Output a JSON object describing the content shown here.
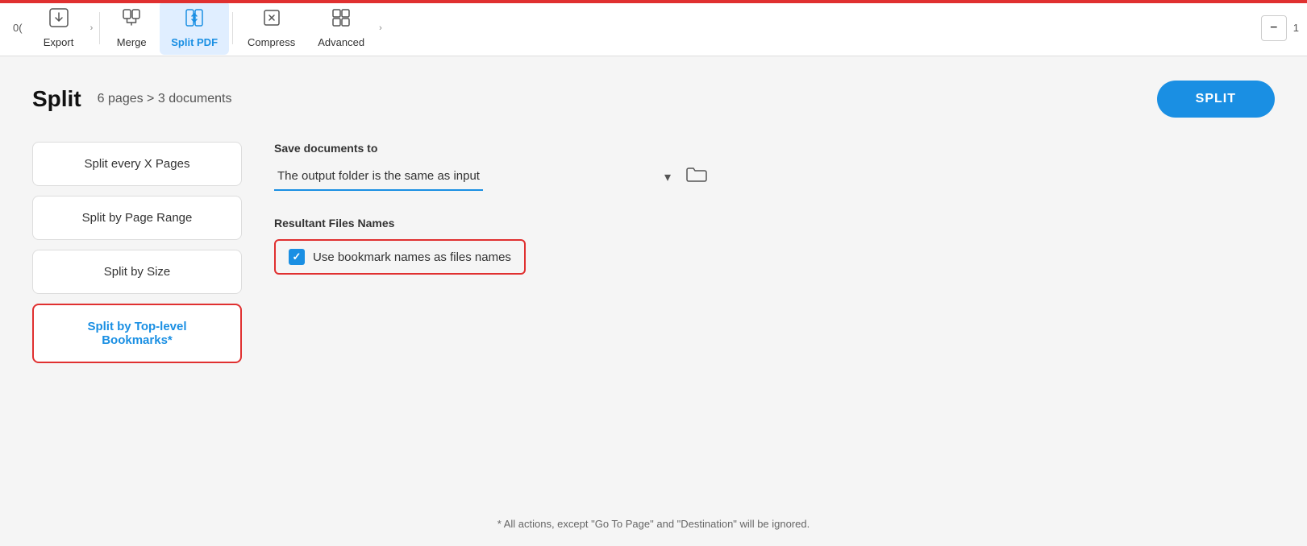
{
  "toolbar": {
    "export_label": "Export",
    "merge_label": "Merge",
    "split_pdf_label": "Split PDF",
    "compress_label": "Compress",
    "advanced_label": "Advanced",
    "chevron_right": "›",
    "zoom_minus": "−"
  },
  "page": {
    "title": "Split",
    "subtitle": "6 pages > 3 documents",
    "split_button_label": "SPLIT"
  },
  "split_options": [
    {
      "id": "split-every-x",
      "label": "Split every X Pages",
      "active": false
    },
    {
      "id": "split-page-range",
      "label": "Split by Page Range",
      "active": false
    },
    {
      "id": "split-size",
      "label": "Split by Size",
      "active": false
    },
    {
      "id": "split-bookmarks",
      "label": "Split by Top-level\nBookmarks*",
      "active": true
    }
  ],
  "save_section": {
    "label": "Save documents to",
    "dropdown_value": "The output folder is the same as input",
    "folder_icon": "📂"
  },
  "resultant_section": {
    "label": "Resultant Files Names",
    "checkbox_label": "Use bookmark names as files names",
    "checked": true
  },
  "footer": {
    "note": "* All actions, except \"Go To Page\" and \"Destination\" will be ignored."
  }
}
